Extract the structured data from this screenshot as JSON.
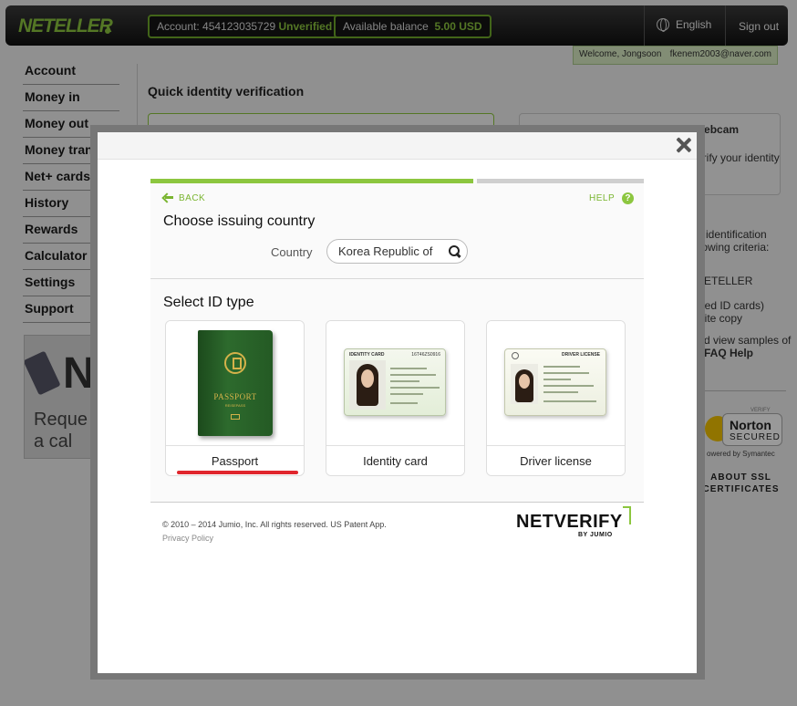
{
  "topbar": {
    "logo": "NETELLER",
    "account_label": "Account: 454123035729",
    "account_status": "Unverified",
    "balance_label": "Available balance",
    "balance_value": "5.00 USD",
    "language": "English",
    "signout": "Sign out",
    "welcome": "Welcome, Jongsoon",
    "email": "fkenem2003@naver.com"
  },
  "sidebar": {
    "items": [
      {
        "label": "Account"
      },
      {
        "label": "Money in"
      },
      {
        "label": "Money out"
      },
      {
        "label": "Money transfer"
      },
      {
        "label": "Net+ cards"
      },
      {
        "label": "History"
      },
      {
        "label": "Rewards"
      },
      {
        "label": "Calculator"
      },
      {
        "label": "Settings"
      },
      {
        "label": "Support"
      }
    ],
    "promo_text_1": "Reque",
    "promo_text_2": "a cal"
  },
  "background": {
    "page_title": "Quick identity verification",
    "webcam_title": "No webcam? Use webcam",
    "webcam_text": "erify your identity",
    "id_text_1": "d identification",
    "id_text_2": "llowing criteria:",
    "neteller": "ETELLER",
    "cards_text": "ired ID cards)",
    "copy_text": "hite copy",
    "samples_text": "d view samples of",
    "faq": "FAQ Help",
    "norton_name": "Norton",
    "norton_secured": "SECURED",
    "norton_verify": "VERIFY",
    "norton_by": "owered by Symantec",
    "about_ssl": "ABOUT SSL CERTIFICATES"
  },
  "modal": {
    "back": "BACK",
    "help": "HELP",
    "help_icon": "?",
    "choose_country": "Choose issuing country",
    "country_label": "Country",
    "country_value": "Korea Republic of",
    "select_id": "Select ID type",
    "id_types": [
      {
        "label": "Passport",
        "selected": true
      },
      {
        "label": "Identity card",
        "selected": false
      },
      {
        "label": "Driver license",
        "selected": false
      }
    ],
    "passport_title": "PASSPORT",
    "passport_sub": "REISEPASS",
    "idcard_head": "IDENTITY CARD",
    "idcard_num": "16T46ZS0916",
    "dl_head": "DRIVER LICENSE",
    "copyright": "© 2010 – 2014 Jumio, Inc. All rights reserved. US Patent App.",
    "privacy": "Privacy Policy",
    "brand": "NETVERIFY",
    "brand_by": "BY JUMIO"
  },
  "colors": {
    "accent_green": "#8cc63f",
    "selected_red": "#e0262d"
  }
}
